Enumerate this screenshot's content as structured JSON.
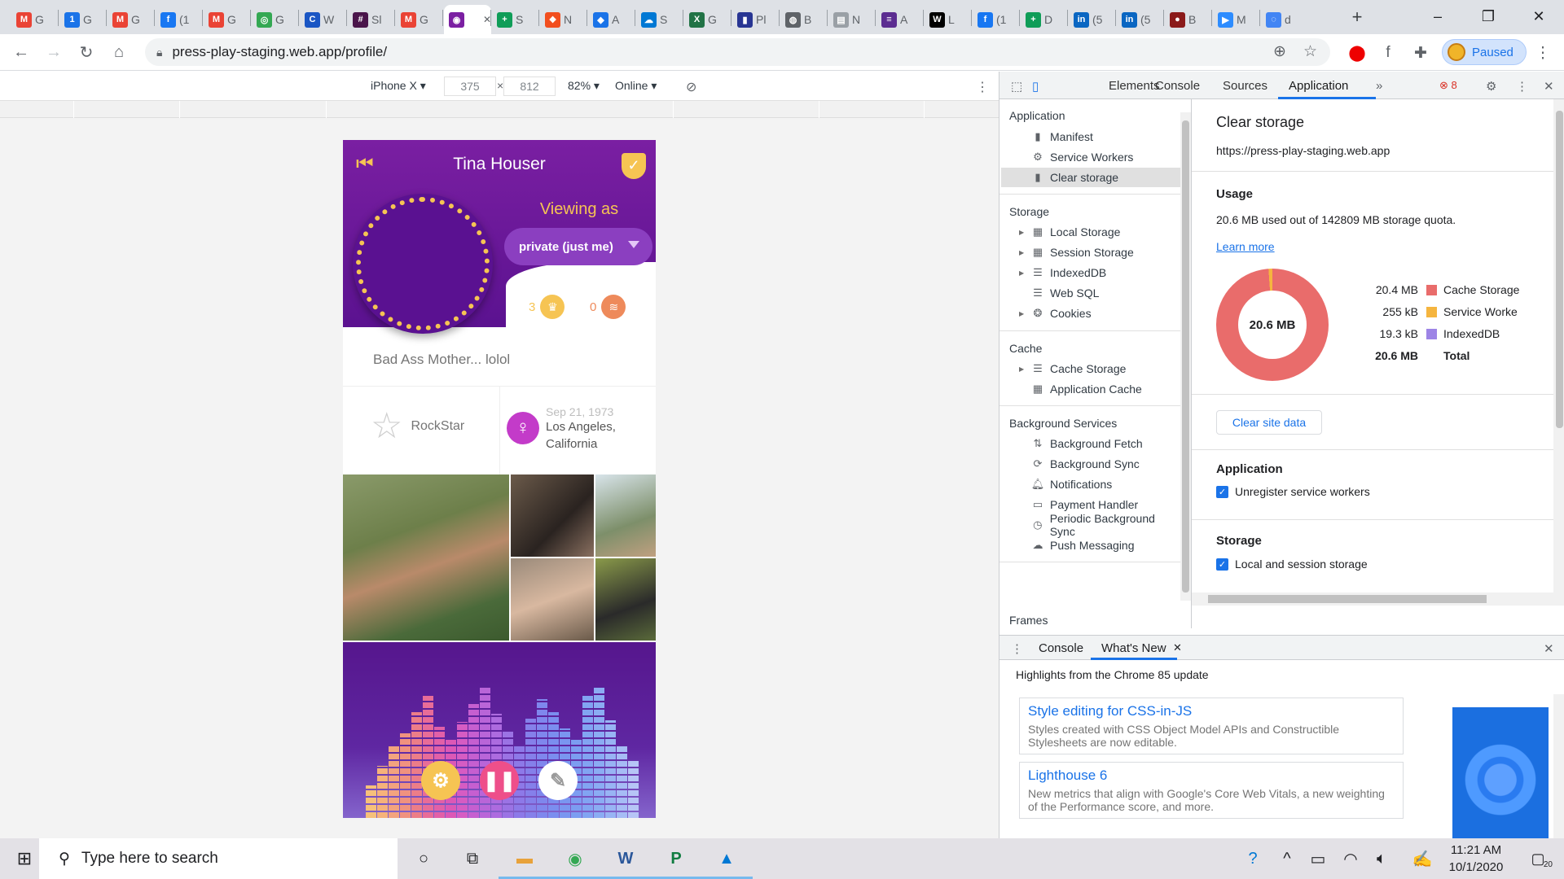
{
  "browser": {
    "tabs": [
      {
        "label": "G",
        "icon": "gmail-icon",
        "color": "#ea4335",
        "glyph": "M"
      },
      {
        "label": "G",
        "icon": "calendar-icon",
        "color": "#1a73e8",
        "glyph": "1"
      },
      {
        "label": "G",
        "icon": "gmail-icon",
        "color": "#ea4335",
        "glyph": "M"
      },
      {
        "label": "(1",
        "icon": "facebook-icon",
        "color": "#1877f2",
        "glyph": "f"
      },
      {
        "label": "G",
        "icon": "gmail-icon",
        "color": "#ea4335",
        "glyph": "M"
      },
      {
        "label": "G",
        "icon": "chrome-icon",
        "color": "#34a853",
        "glyph": "◎"
      },
      {
        "label": "W",
        "icon": "c-app-icon",
        "color": "#1a56c4",
        "glyph": "C"
      },
      {
        "label": "Sl",
        "icon": "slack-icon",
        "color": "#4a154b",
        "glyph": "#"
      },
      {
        "label": "G",
        "icon": "gmail-icon",
        "color": "#ea4335",
        "glyph": "M"
      },
      {
        "label": "",
        "icon": "press-play-icon",
        "color": "#7b1fa2",
        "glyph": "◉",
        "active": true
      },
      {
        "label": "S",
        "icon": "sheets-plus-icon",
        "color": "#0f9d58",
        "glyph": "+"
      },
      {
        "label": "N",
        "icon": "figma-icon",
        "color": "#f24e1e",
        "glyph": "❖"
      },
      {
        "label": "A",
        "icon": "diamond-icon",
        "color": "#1a73e8",
        "glyph": "◆"
      },
      {
        "label": "S",
        "icon": "cloud-icon",
        "color": "#0078d4",
        "glyph": "☁"
      },
      {
        "label": "G",
        "icon": "excel-icon",
        "color": "#217346",
        "glyph": "X"
      },
      {
        "label": "Pl",
        "icon": "bookmark-icon",
        "color": "#283593",
        "glyph": "▮"
      },
      {
        "label": "B",
        "icon": "globe-icon",
        "color": "#5f6368",
        "glyph": "◍"
      },
      {
        "label": "N",
        "icon": "doc-icon",
        "color": "#9aa0a6",
        "glyph": "▤"
      },
      {
        "label": "A",
        "icon": "list-icon",
        "color": "#5c2d91",
        "glyph": "≡"
      },
      {
        "label": "L",
        "icon": "wix-icon",
        "color": "#000000",
        "glyph": "W"
      },
      {
        "label": "(1",
        "icon": "facebook-icon",
        "color": "#1877f2",
        "glyph": "f"
      },
      {
        "label": "D",
        "icon": "sheets-plus-icon",
        "color": "#0f9d58",
        "glyph": "+"
      },
      {
        "label": "(5",
        "icon": "linkedin-icon",
        "color": "#0a66c2",
        "glyph": "in"
      },
      {
        "label": "(5",
        "icon": "linkedin-icon",
        "color": "#0a66c2",
        "glyph": "in"
      },
      {
        "label": "B",
        "icon": "profile-icon",
        "color": "#8b1a1a",
        "glyph": "●"
      },
      {
        "label": "M",
        "icon": "zoom-icon",
        "color": "#2d8cff",
        "glyph": "▶"
      },
      {
        "label": "d",
        "icon": "loader-icon",
        "color": "#4285f4",
        "glyph": "◌"
      }
    ],
    "url": "press-play-staging.web.app/profile/",
    "profile_status": "Paused"
  },
  "device_toolbar": {
    "device": "iPhone X",
    "width": "375",
    "height": "812",
    "zoom": "82%",
    "network": "Online"
  },
  "profile": {
    "name": "Tina Houser",
    "viewing_as_label": "Viewing as",
    "visibility": "private (just me)",
    "crowns_count": "3",
    "plays_count": "0",
    "bio": "Bad Ass Mother... lolol",
    "rank": "RockStar",
    "birthdate": "Sep 21, 1973",
    "location": "Los Angeles, California"
  },
  "devtools": {
    "tabs": [
      "Elements",
      "Console",
      "Sources",
      "Application"
    ],
    "selected_tab": "Application",
    "error_count": "8",
    "sidebar": {
      "application_header": "Application",
      "application_items": [
        "Manifest",
        "Service Workers",
        "Clear storage"
      ],
      "selected_item": "Clear storage",
      "storage_header": "Storage",
      "storage_items": [
        "Local Storage",
        "Session Storage",
        "IndexedDB",
        "Web SQL",
        "Cookies"
      ],
      "cache_header": "Cache",
      "cache_items": [
        "Cache Storage",
        "Application Cache"
      ],
      "background_header": "Background Services",
      "background_items": [
        "Background Fetch",
        "Background Sync",
        "Notifications",
        "Payment Handler",
        "Periodic Background Sync",
        "Push Messaging"
      ],
      "frames_header": "Frames"
    },
    "clear_storage": {
      "title": "Clear storage",
      "origin": "https://press-play-staging.web.app",
      "usage_header": "Usage",
      "usage_text": "20.6 MB used out of 142809 MB storage quota.",
      "learn_more": "Learn more",
      "donut_total": "20.6 MB",
      "legend": [
        {
          "value": "20.4 MB",
          "label": "Cache Storage",
          "color": "#e96c6b"
        },
        {
          "value": "255 kB",
          "label": "Service Worke",
          "color": "#f5b53f"
        },
        {
          "value": "19.3 kB",
          "label": "IndexedDB",
          "color": "#9d84e6"
        }
      ],
      "total_value": "20.6 MB",
      "total_label": "Total",
      "clear_button": "Clear site data",
      "application_section": "Application",
      "unregister_sw": "Unregister service workers",
      "storage_section": "Storage",
      "local_session": "Local and session storage"
    },
    "drawer": {
      "tabs": [
        "Console",
        "What's New"
      ],
      "selected": "What's New",
      "highlights": "Highlights from the Chrome 85 update",
      "cards": [
        {
          "title": "Style editing for CSS-in-JS",
          "desc": "Styles created with CSS Object Model APIs and Constructible Stylesheets are now editable."
        },
        {
          "title": "Lighthouse 6",
          "desc": "New metrics that align with Google's Core Web Vitals, a new weighting of the Performance score, and more."
        }
      ]
    }
  },
  "taskbar": {
    "search_placeholder": "Type here to search",
    "time": "11:21 AM",
    "date": "10/1/2020",
    "notification_count": "20"
  }
}
